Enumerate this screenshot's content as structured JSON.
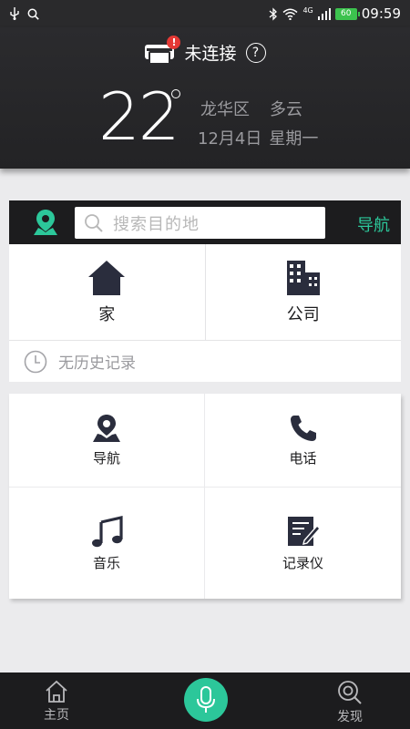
{
  "status_bar": {
    "time": "09:59",
    "battery": "60",
    "network": "4G"
  },
  "header": {
    "connection_status": "未连接",
    "help_symbol": "?",
    "badge": "!",
    "temperature": "22",
    "district": "龙华区",
    "weather": "多云",
    "date": "12月4日",
    "weekday": "星期一"
  },
  "search": {
    "placeholder": "搜索目的地",
    "nav_label": "导航"
  },
  "places": {
    "home_label": "家",
    "company_label": "公司",
    "history_text": "无历史记录"
  },
  "grid": {
    "navigation_label": "导航",
    "phone_label": "电话",
    "music_label": "音乐",
    "recorder_label": "记录仪"
  },
  "bottom_nav": {
    "home_label": "主页",
    "discover_label": "发现"
  },
  "colors": {
    "accent": "#2cc79a",
    "dark": "#1c1c1e",
    "badge": "#e53935"
  },
  "icons": [
    "usb-icon",
    "search-icon",
    "bluetooth-icon",
    "wifi-icon",
    "signal-icon",
    "printer-icon",
    "help-icon",
    "location-pin-icon",
    "home-icon",
    "building-icon",
    "clock-icon",
    "navigation-pin-icon",
    "phone-icon",
    "music-note-icon",
    "notepad-icon",
    "home-tab-icon",
    "microphone-icon",
    "discover-icon"
  ]
}
